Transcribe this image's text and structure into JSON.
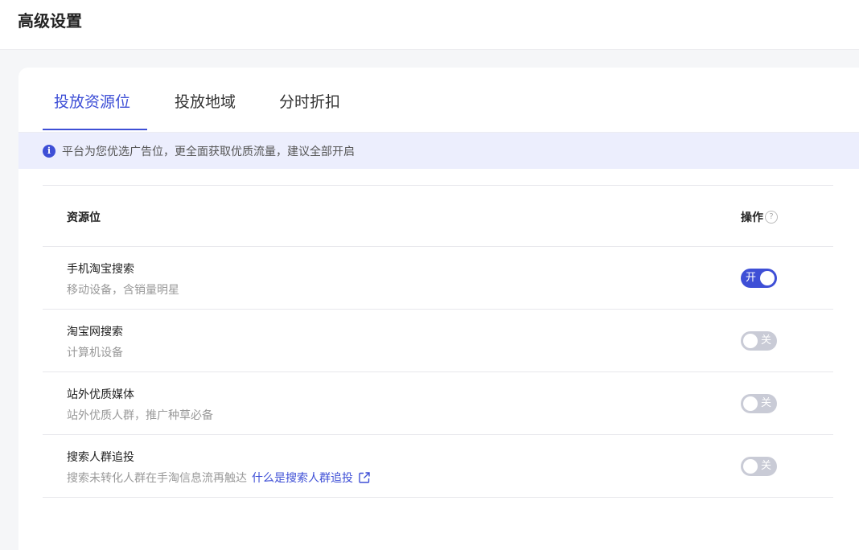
{
  "header": {
    "title": "高级设置"
  },
  "tabs": [
    {
      "label": "投放资源位",
      "active": true
    },
    {
      "label": "投放地域",
      "active": false
    },
    {
      "label": "分时折扣",
      "active": false
    }
  ],
  "notice": {
    "icon": "info-icon",
    "text": "平台为您优选广告位，更全面获取优质流量，建议全部开启"
  },
  "table": {
    "col_resource": "资源位",
    "col_action": "操作",
    "help_icon": "help-circle-icon",
    "rows": [
      {
        "name": "手机淘宝搜索",
        "desc": "移动设备，含销量明星",
        "enabled": true,
        "toggle_label": "开"
      },
      {
        "name": "淘宝网搜索",
        "desc": "计算机设备",
        "enabled": false,
        "toggle_label": "关"
      },
      {
        "name": "站外优质媒体",
        "desc": "站外优质人群，推广种草必备",
        "enabled": false,
        "toggle_label": "关"
      },
      {
        "name": "搜索人群追投",
        "desc": "搜索未转化人群在手淘信息流再触达",
        "link": "什么是搜索人群追投",
        "link_icon": "external-link-icon",
        "enabled": false,
        "toggle_label": "关"
      }
    ]
  },
  "colors": {
    "accent": "#3e4fd6",
    "notice_bg": "#eceefd",
    "toggle_off": "#c9cbd6"
  }
}
